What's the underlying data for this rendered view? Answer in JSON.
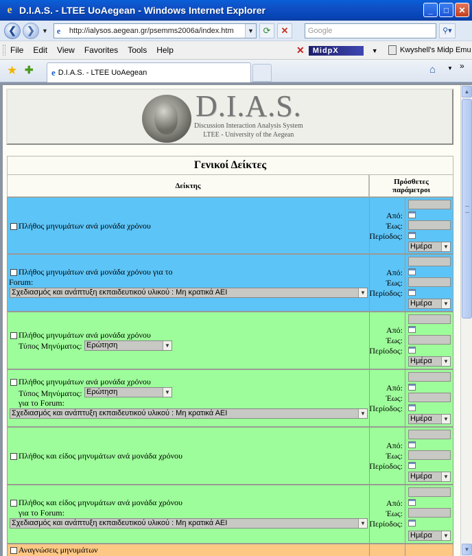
{
  "window": {
    "title": "D.I.A.S. - LTEE UoAegean - Windows Internet Explorer",
    "minimize": "_",
    "maximize": "□",
    "close": "✕"
  },
  "address_bar": {
    "url": "http://ialysos.aegean.gr/psemms2006a/index.htm",
    "search_placeholder": "Google"
  },
  "menu": {
    "items": [
      "File",
      "Edit",
      "View",
      "Favorites",
      "Tools",
      "Help"
    ],
    "midp_label": "MidpX",
    "kwyshell_label": "Kwyshell's Midp Emu"
  },
  "tabs": {
    "active_tab": "D.I.A.S. - LTEE UoAegean"
  },
  "banner": {
    "title": "D.I.A.S.",
    "subtitle1": "Discussion Interaction Analysis System",
    "subtitle2": "LTEE - University of the Aegean"
  },
  "table": {
    "heading": "Γενικοί Δείκτες",
    "col_indicator": "Δείκτης",
    "col_params_line1": "Πρόσθετες",
    "col_params_line2": "παράμετροι",
    "label_from": "Από:",
    "label_to": "Έως:",
    "label_period": "Περίοδος:",
    "period_value": "Ημέρα",
    "label_forum": "Forum:",
    "label_for_forum": "για το Forum:",
    "label_msg_type": "Τύπος Μηνύματος:",
    "msg_type_value": "Ερώτηση",
    "forum_value": "Σχεδιασμός και ανάπτυξη εκπαιδευτικού υλικού : Μη κρατικά ΑΕΙ",
    "rows": [
      {
        "text": "Πλήθος μηνυμάτων ανά μονάδα χρόνου"
      },
      {
        "text": "Πλήθος μηνυμάτων ανά μονάδα χρόνου για το"
      },
      {
        "text": "Πλήθος μηνυμάτων ανά μονάδα χρόνου"
      },
      {
        "text": "Πλήθος μηνυμάτων ανά μονάδα χρόνου"
      },
      {
        "text": "Πλήθος και είδος μηνυμάτων ανά μονάδα χρόνου"
      },
      {
        "text": "Πλήθος και είδος μηνυμάτων ανά μονάδα χρόνου"
      },
      {
        "text": "Αναγνώσεις μηνυμάτων"
      }
    ]
  },
  "colors": {
    "row_blue": "#5cc4f7",
    "row_green": "#9dfd9a",
    "row_orange": "#fdc784"
  }
}
